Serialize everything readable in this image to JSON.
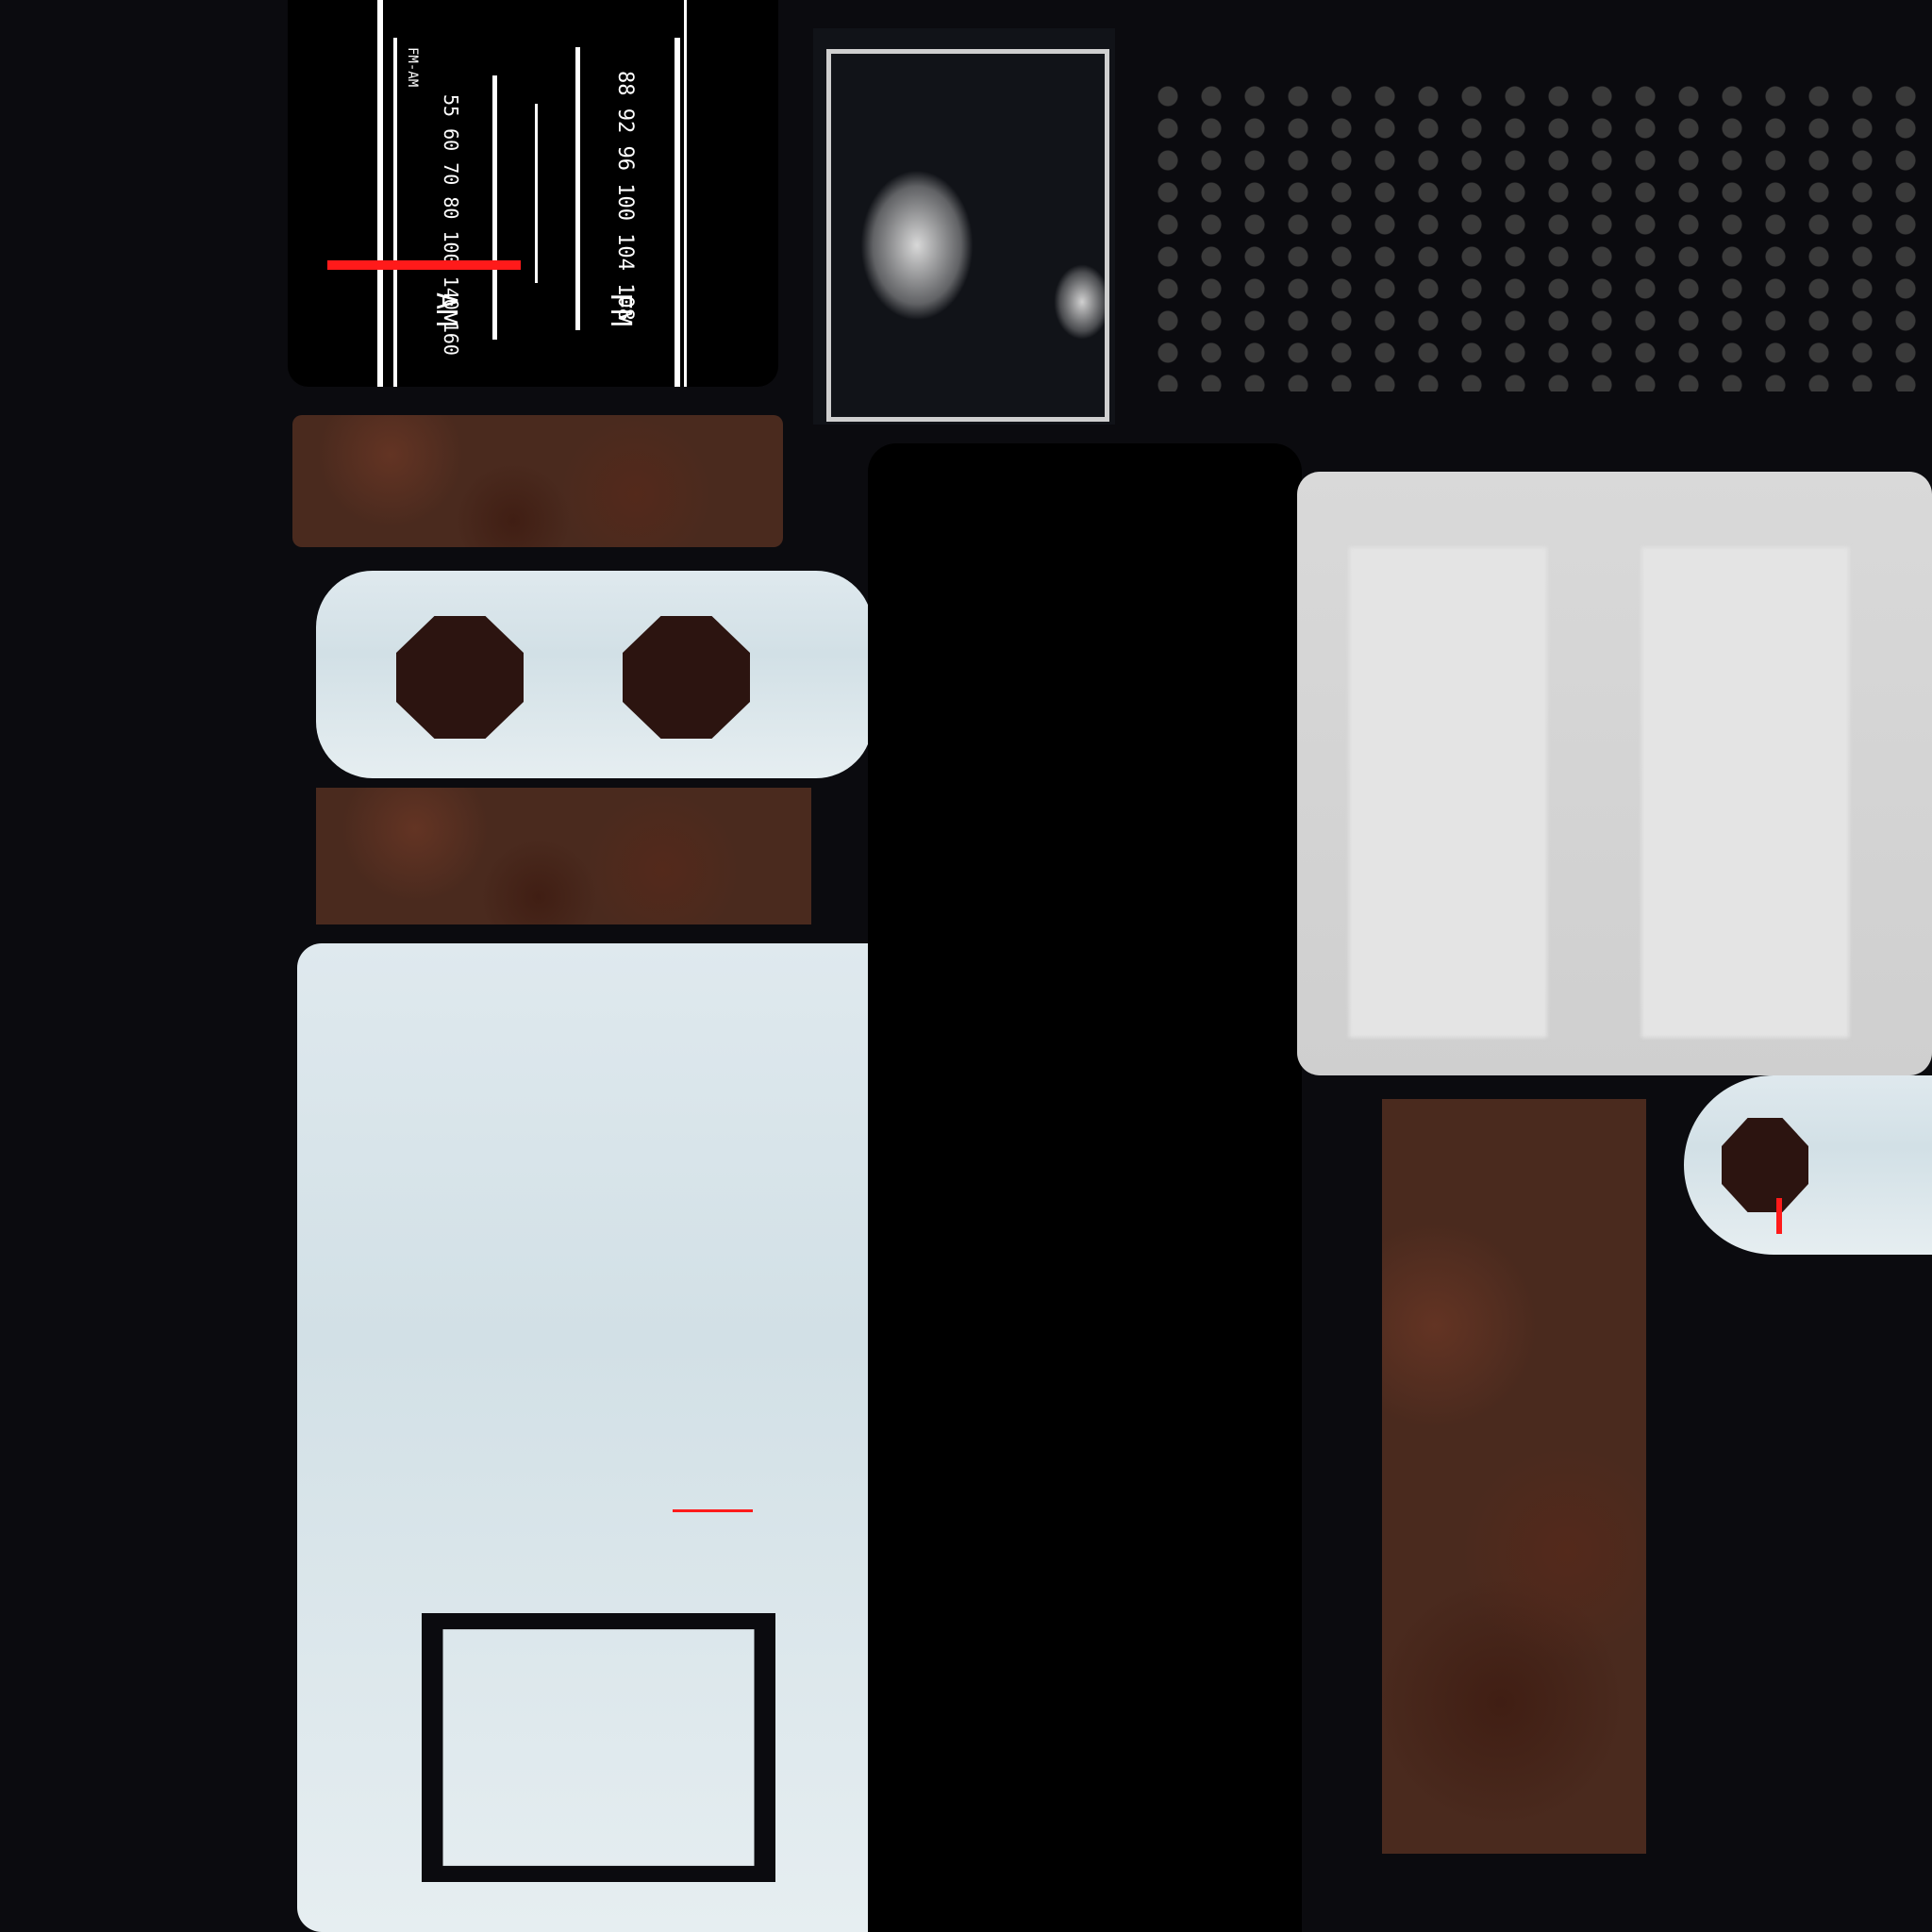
{
  "dial": {
    "band_fm": "FM",
    "band_am": "AM",
    "brand": "FM-AM",
    "fm_scale": "88 92 96 100 104 108",
    "am_scale": "55 60 70 80 100 140 160"
  },
  "colors": {
    "background": "#0b0b0f",
    "rust": "#4a2a1e",
    "pale": "#dfe9ee",
    "needle": "#ff1a1a",
    "speaker_dot": "#3a3a3a"
  },
  "icons": [
    "dial-face-icon",
    "speaker-grille-icon",
    "knob-hole-icon"
  ]
}
